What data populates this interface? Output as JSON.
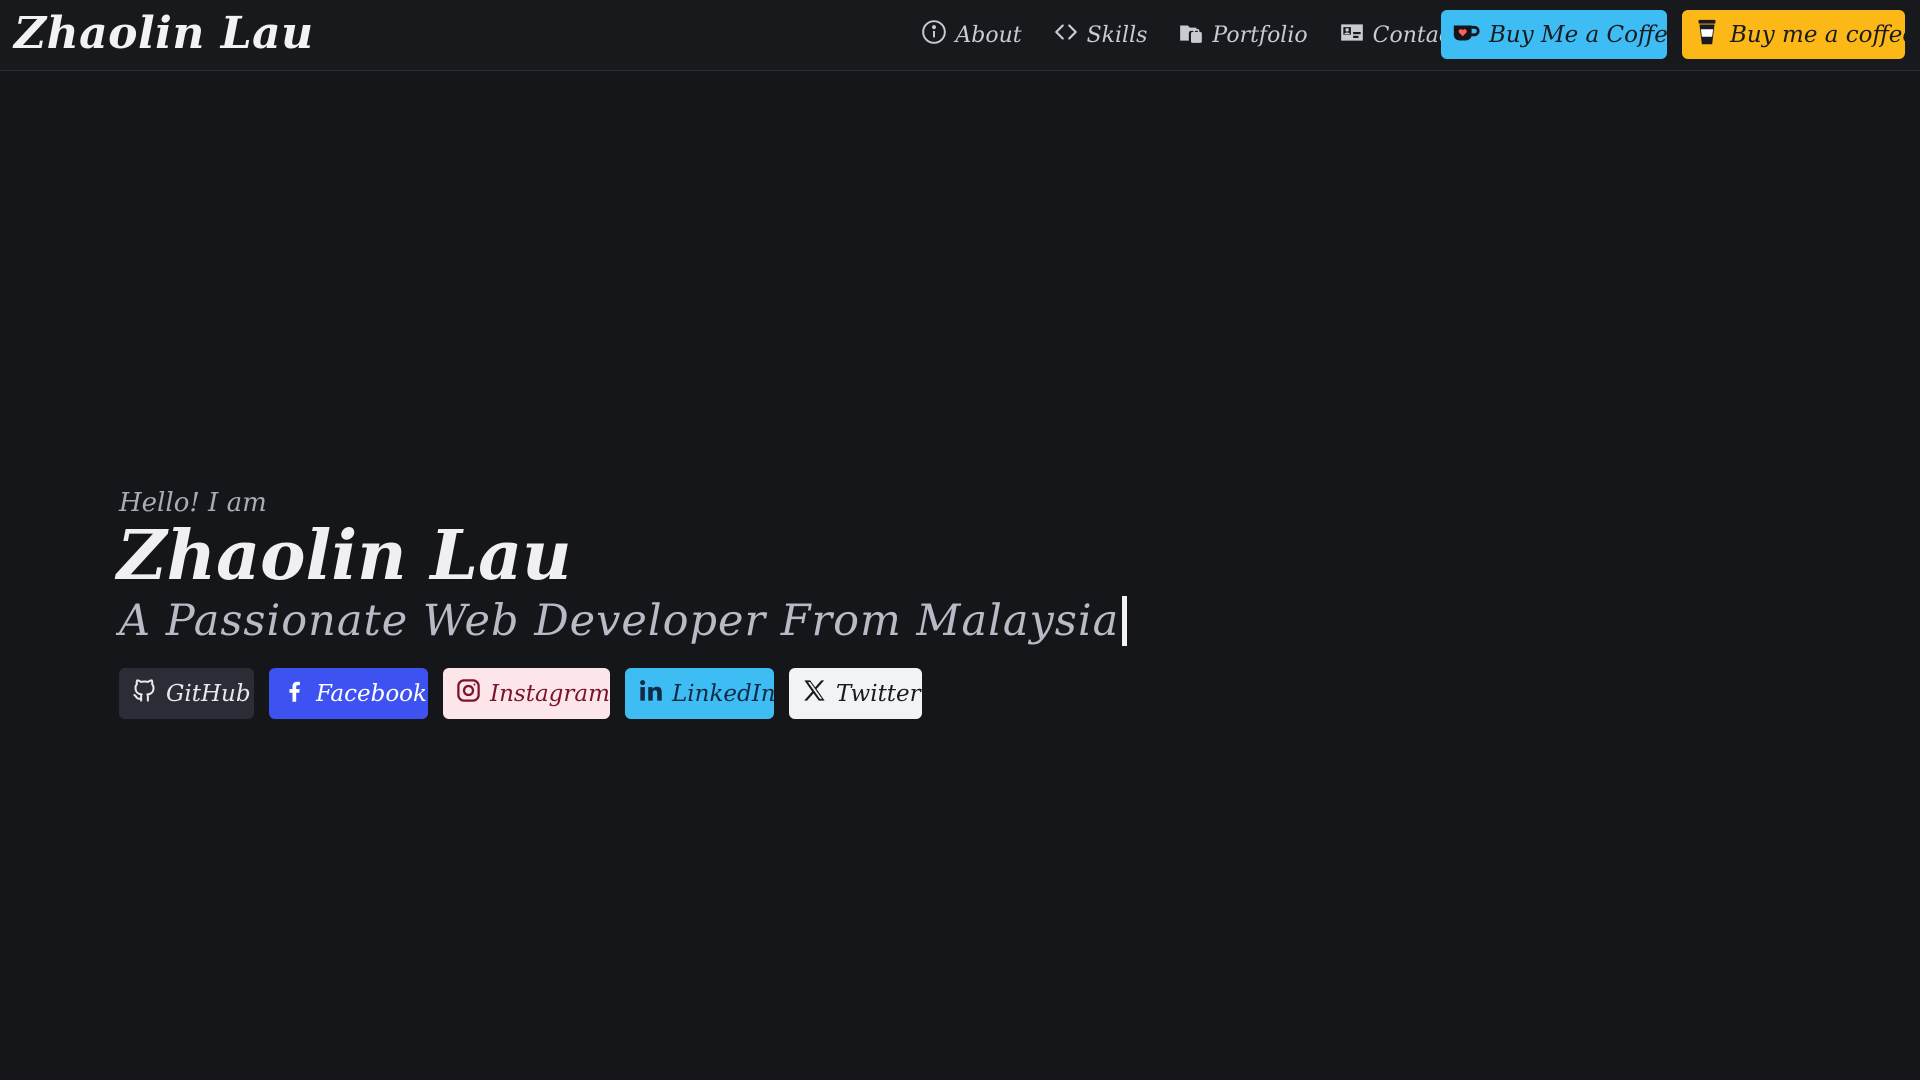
{
  "navbar": {
    "brand": "Zhaolin Lau",
    "links": [
      {
        "label": "About",
        "icon": "info-icon"
      },
      {
        "label": "Skills",
        "icon": "code-icon"
      },
      {
        "label": "Portfolio",
        "icon": "portfolio-icon"
      },
      {
        "label": "Contact",
        "icon": "contact-card-icon"
      }
    ],
    "coffee_buttons": [
      {
        "label": "Buy Me a Coffee",
        "icon": "kofi-cup-icon",
        "color": "#3dbdf3"
      },
      {
        "label": "Buy me a coffee",
        "icon": "coffee-cup-icon",
        "color": "#fcb817"
      }
    ]
  },
  "hero": {
    "greeting": "Hello! I am",
    "name": "Zhaolin Lau",
    "tagline": "A Passionate Web Developer From Malaysia"
  },
  "socials": [
    {
      "label": "GitHub",
      "icon": "github-icon",
      "color": "#2a2d35"
    },
    {
      "label": "Facebook",
      "icon": "facebook-icon",
      "color": "#3e52f2"
    },
    {
      "label": "Instagram",
      "icon": "instagram-icon",
      "color": "#fde6ea"
    },
    {
      "label": "LinkedIn",
      "icon": "linkedin-icon",
      "color": "#3dbdf3"
    },
    {
      "label": "Twitter",
      "icon": "x-twitter-icon",
      "color": "#f2f3f5"
    }
  ],
  "colors": {
    "background": "#15161a",
    "navbar": "#18191d"
  }
}
